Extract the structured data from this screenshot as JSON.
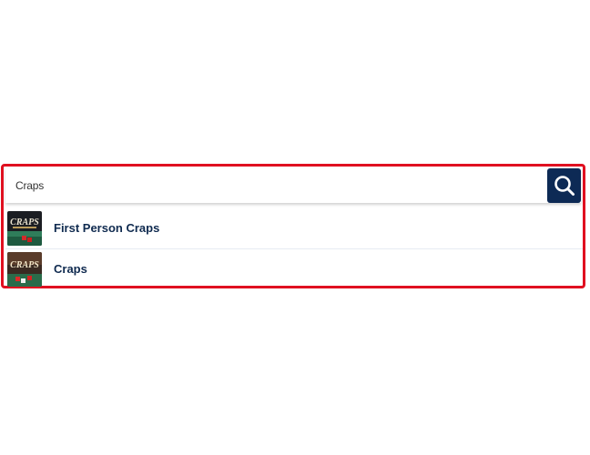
{
  "search": {
    "value": "Craps",
    "button_icon": "search-icon"
  },
  "results": [
    {
      "label": "First Person Craps",
      "thumb_text": "CRAPS"
    },
    {
      "label": "Craps",
      "thumb_text": "CRAPS"
    }
  ],
  "colors": {
    "highlight": "#e01020",
    "search_button": "#0d2a55",
    "result_text": "#0f2a4f"
  }
}
